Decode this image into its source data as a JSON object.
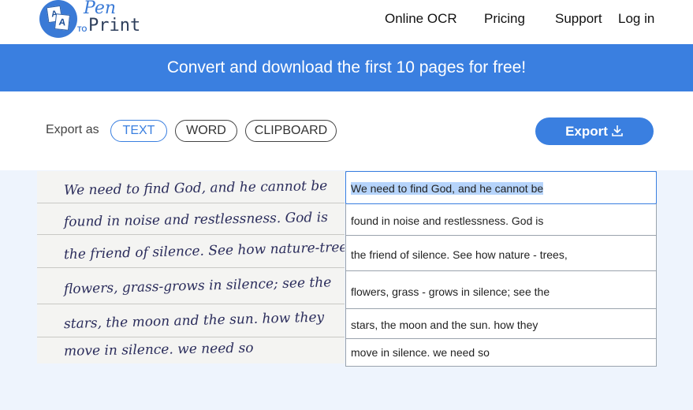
{
  "brand": {
    "pen": "Pen",
    "to": "TO",
    "print": "Print",
    "card_a": "A",
    "card_b": "A"
  },
  "nav": {
    "online_ocr": "Online OCR",
    "pricing": "Pricing",
    "support": "Support",
    "login": "Log in"
  },
  "banner": {
    "text": "Convert and download the first 10 pages for free!"
  },
  "toolbar": {
    "export_as": "Export as",
    "formats": [
      "TEXT",
      "WORD",
      "CLIPBOARD"
    ],
    "selected_format": "TEXT",
    "export_button": "Export"
  },
  "scan": {
    "lines": [
      "We need to find God, and he cannot be",
      "found in noise and restlessness. God is",
      "the friend of silence. See how nature-trees,",
      "flowers, grass-grows in silence; see the",
      "stars, the moon and the sun. how they",
      "move in silence. we need so"
    ]
  },
  "ocr": {
    "lines": [
      "We need to find God, and he cannot be",
      "found in noise and restlessness. God is",
      "the friend of silence. See how nature - trees,",
      "flowers, grass - grows in silence; see the",
      "stars, the moon and the sun. how they",
      "move in silence. we need so"
    ]
  },
  "colors": {
    "accent": "#3a7fe0",
    "content_bg": "#eef4fd",
    "selection": "#b6d4fb"
  }
}
